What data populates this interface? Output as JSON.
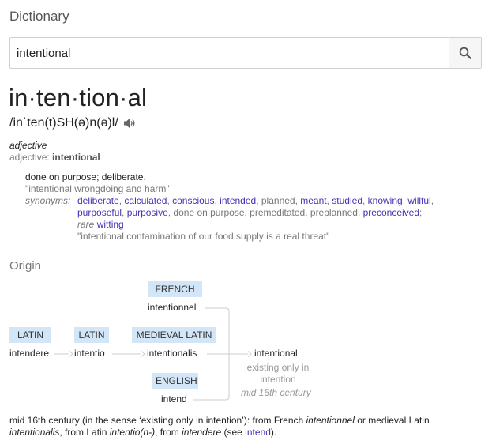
{
  "app": {
    "title": "Dictionary"
  },
  "search": {
    "value": "intentional",
    "button_icon": "search-icon"
  },
  "entry": {
    "headword": "in·ten·tion·al",
    "phonetic": "/inˈten(t)SH(ə)n(ə)l/",
    "audio_icon": "speaker-icon",
    "pos": "adjective",
    "pos_line_prefix": "adjective:",
    "pos_line_word": "intentional",
    "definition": "done on purpose; deliberate.",
    "example": "\"intentional wrongdoing and harm\"",
    "synonyms_label": "synonyms:",
    "synonyms": [
      {
        "text": "deliberate",
        "link": true
      },
      {
        "text": "calculated",
        "link": true
      },
      {
        "text": "conscious",
        "link": true
      },
      {
        "text": "intended",
        "link": true
      },
      {
        "text": "planned",
        "link": false
      },
      {
        "text": "meant",
        "link": true
      },
      {
        "text": "studied",
        "link": true
      },
      {
        "text": "knowing",
        "link": true
      },
      {
        "text": "willful",
        "link": true
      },
      {
        "text": "purposeful",
        "link": true
      },
      {
        "text": "purposive",
        "link": true
      },
      {
        "text": "done on purpose",
        "link": false
      },
      {
        "text": "premeditated",
        "link": false
      },
      {
        "text": "preplanned",
        "link": false
      },
      {
        "text": "preconceived",
        "link": true
      }
    ],
    "rare_label": "rare",
    "rare_word": "witting",
    "example2": "\"intentional contamination of our food supply is a real threat\""
  },
  "origin": {
    "title": "Origin",
    "tags": {
      "french": "FRENCH",
      "latin1": "LATIN",
      "latin2": "LATIN",
      "medieval_latin": "MEDIEVAL LATIN",
      "english": "ENGLISH"
    },
    "words": {
      "intentionnel": "intentionnel",
      "intendere": "intendere",
      "intentio": "intentio",
      "intentionalis": "intentionalis",
      "intend": "intend",
      "intentional": "intentional"
    },
    "gloss": "existing only in intention",
    "gloss_line1": "existing only in",
    "gloss_line2": "intention",
    "date": "mid 16th century",
    "text": {
      "p1": "mid 16th century (in the sense ‘existing only in intention’): from French ",
      "w1": "intentionnel",
      "p2": " or medieval Latin ",
      "w2": "intentionalis",
      "p3": ", from Latin ",
      "w3": "intentio(n-)",
      "p4": ", from ",
      "w4": "intendere",
      "p5": " (see ",
      "link": "intend",
      "p6": ")."
    }
  },
  "colors": {
    "tag_bg": "#d2e6f7",
    "link": "#4a2fb5",
    "muted": "#777777"
  }
}
